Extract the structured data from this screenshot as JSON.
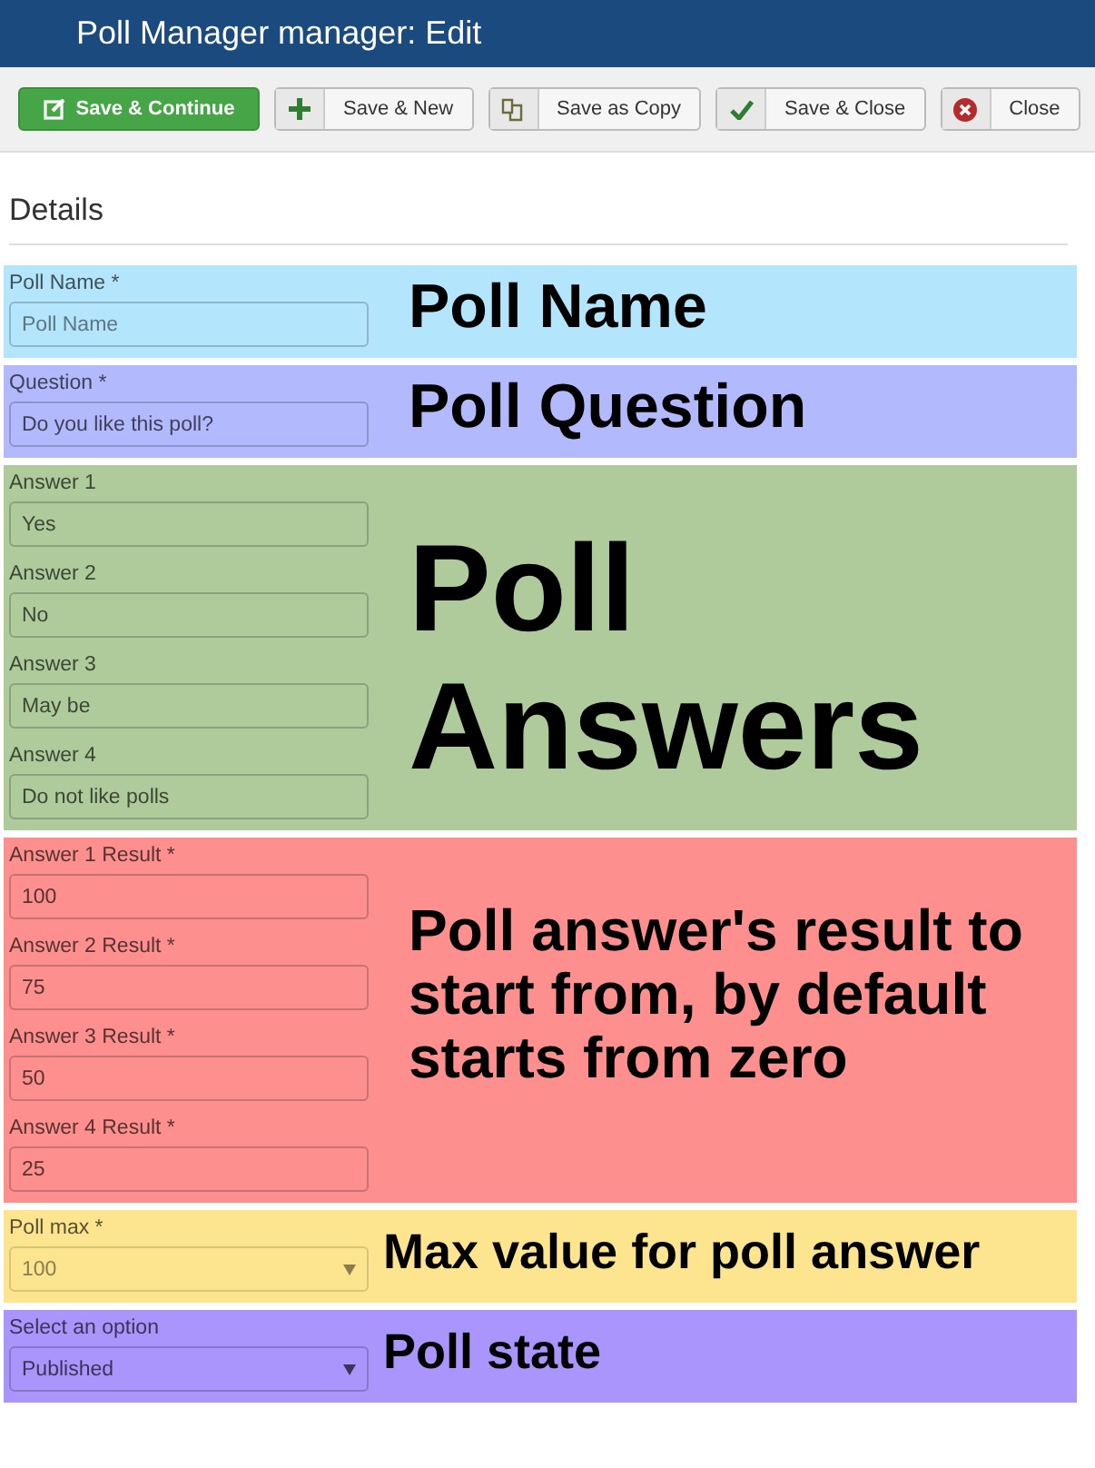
{
  "window": {
    "title": "Poll Manager manager: Edit"
  },
  "toolbar": [
    {
      "label": "Save & Continue",
      "kind": "primary"
    },
    {
      "label": "Save & New",
      "kind": "default"
    },
    {
      "label": "Save as Copy",
      "kind": "default"
    },
    {
      "label": "Save & Close",
      "kind": "default"
    },
    {
      "label": "Close",
      "kind": "default"
    }
  ],
  "heading": "Details",
  "sections": [
    {
      "color": "#b3e5fc",
      "kind": "title",
      "annotation": "Poll Name",
      "fields": [
        {
          "label": "Poll Name *",
          "kind": "text",
          "placeholder": "Poll Name"
        }
      ]
    },
    {
      "color": "#b3b9fd",
      "kind": "title",
      "annotation": "Poll Question",
      "fields": [
        {
          "label": "Question *",
          "kind": "text",
          "value": "Do you like this poll?"
        }
      ]
    },
    {
      "color": "#afca9b",
      "kind": "display",
      "annotation": "Poll Answers",
      "fields": [
        {
          "label": "Answer 1",
          "kind": "text",
          "value": "Yes"
        },
        {
          "label": "Answer 2",
          "kind": "text",
          "value": "No"
        },
        {
          "label": "Answer 3",
          "kind": "text",
          "value": "May be"
        },
        {
          "label": "Answer 4",
          "kind": "text",
          "value": "Do not like polls"
        }
      ]
    },
    {
      "color": "#fd8f8f",
      "kind": "body",
      "annotation": "Poll answer's result to start from, by default starts from zero",
      "fields": [
        {
          "label": "Answer 1 Result *",
          "kind": "text",
          "value": "100"
        },
        {
          "label": "Answer 2 Result *",
          "kind": "text",
          "value": "75"
        },
        {
          "label": "Answer 3 Result *",
          "kind": "text",
          "value": "50"
        },
        {
          "label": "Answer 4 Result *",
          "kind": "text",
          "value": "25"
        }
      ]
    },
    {
      "color": "#fde58f",
      "kind": "caption",
      "annotation": "Max value for poll answer",
      "fields": [
        {
          "label": "Poll max *",
          "kind": "select",
          "value": "100",
          "disabled": true
        }
      ]
    },
    {
      "color": "#a995fc",
      "kind": "caption",
      "annotation": "Poll state",
      "fields": [
        {
          "label": "Select an option",
          "kind": "select",
          "value": "Published",
          "disabled": false
        }
      ]
    }
  ]
}
